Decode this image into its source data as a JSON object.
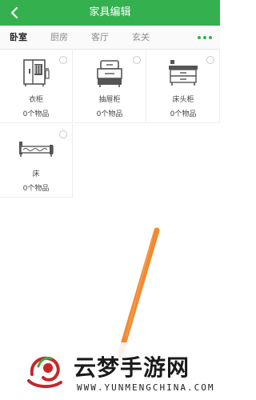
{
  "header": {
    "title": "家具编辑",
    "back_icon": "chevron-left-icon"
  },
  "tabs": [
    {
      "label": "卧室",
      "active": true
    },
    {
      "label": "厨房",
      "active": false
    },
    {
      "label": "客厅",
      "active": false
    },
    {
      "label": "玄关",
      "active": false
    }
  ],
  "more_icon": "more-dots-icon",
  "furniture": [
    {
      "name": "衣柜",
      "count": "0个物品",
      "icon": "wardrobe-icon",
      "selected": false
    },
    {
      "name": "抽屉柜",
      "count": "0个物品",
      "icon": "drawer-cabinet-icon",
      "selected": false
    },
    {
      "name": "床头柜",
      "count": "0个物品",
      "icon": "nightstand-icon",
      "selected": false
    },
    {
      "name": "床",
      "count": "0个物品",
      "icon": "bed-icon",
      "selected": false
    }
  ],
  "watermark": {
    "title": "云梦手游网",
    "subtitle": "WWW.YUNMENGCHINA.COM"
  },
  "colors": {
    "accent": "#35b04f",
    "annotation": "#f28a2e"
  }
}
